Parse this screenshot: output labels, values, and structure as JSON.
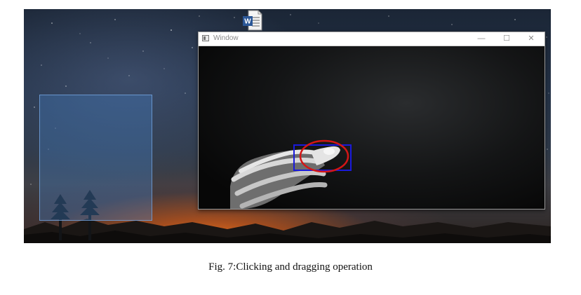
{
  "desktop": {
    "wallpaper": "night-sky-mountains",
    "word_icon": "word-document-icon",
    "word_icon_letter": "W"
  },
  "window": {
    "title": "Window",
    "controls": {
      "minimize": "—",
      "maximize": "☐",
      "close": "✕"
    }
  },
  "colors": {
    "detection_box": "#1a1adb",
    "tracking_ellipse": "#d41616",
    "selection_fill": "#4682c8"
  },
  "caption": "Fig. 7:Clicking and dragging operation"
}
